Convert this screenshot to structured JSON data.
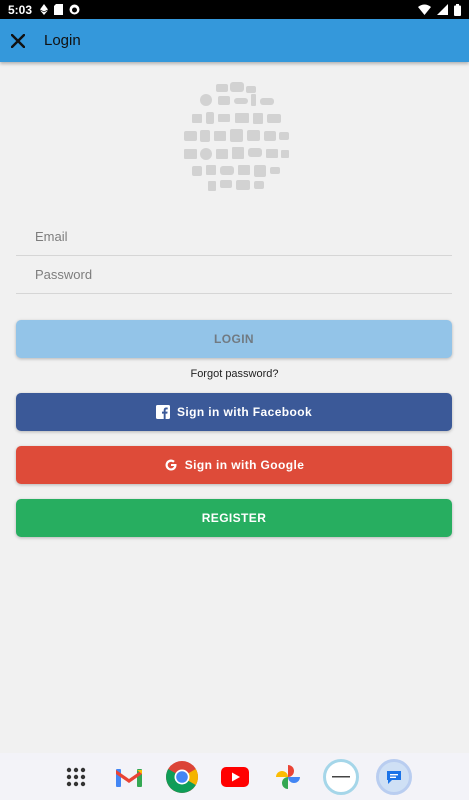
{
  "status_bar": {
    "time": "5:03"
  },
  "app_bar": {
    "title": "Login"
  },
  "form": {
    "email_placeholder": "Email",
    "password_placeholder": "Password"
  },
  "buttons": {
    "login": "LOGIN",
    "forgot": "Forgot password?",
    "facebook": "Sign in with Facebook",
    "google": "Sign in with Google",
    "register": "REGISTER"
  },
  "colors": {
    "app_bar": "#3498db",
    "login": "#93c4e8",
    "facebook": "#3b5998",
    "google": "#de4b39",
    "register": "#27ae60"
  },
  "dock": {
    "apps": [
      "app-drawer-icon",
      "gmail-icon",
      "chrome-icon",
      "youtube-icon",
      "photos-icon",
      "app-icon",
      "messages-icon"
    ]
  }
}
